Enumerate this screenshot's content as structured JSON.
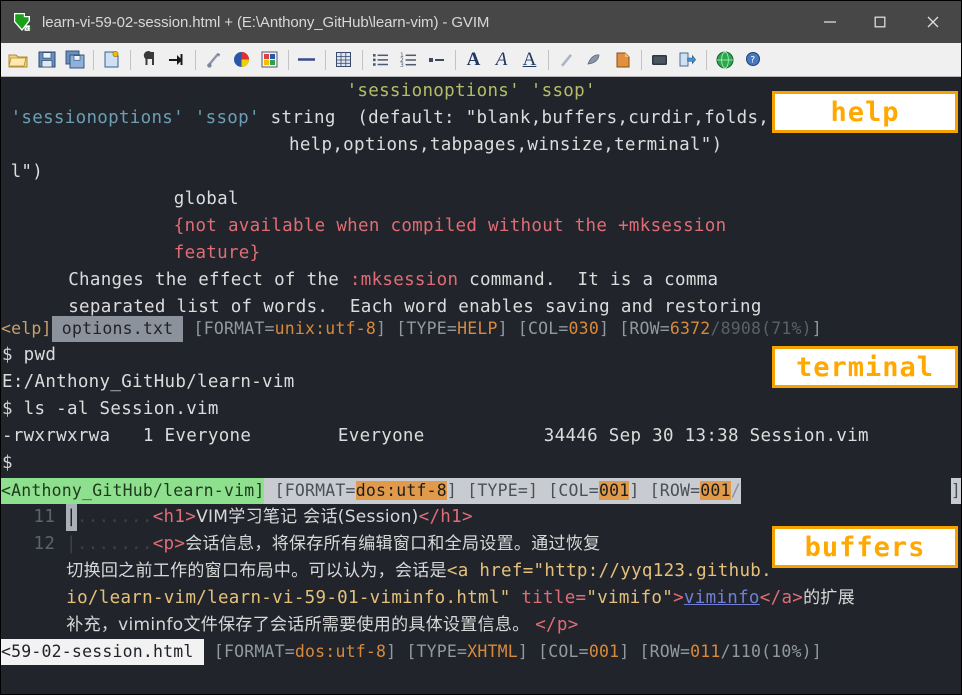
{
  "window": {
    "title": "learn-vi-59-02-session.html + (E:\\Anthony_GitHub\\learn-vim) - GVIM",
    "logo_name": "vim-logo",
    "controls": {
      "minimize": "minimize",
      "maximize": "maximize",
      "close": "close"
    }
  },
  "toolbar": {
    "items": [
      {
        "name": "open-file-icon",
        "tip": "Open"
      },
      {
        "name": "save-file-icon",
        "tip": "Save"
      },
      {
        "name": "save-all-icon",
        "tip": "Save All"
      },
      {
        "name": "print-icon",
        "tip": "Print"
      },
      {
        "name": "undo-icon",
        "tip": "Undo"
      },
      {
        "name": "redo-icon",
        "tip": "Redo"
      },
      {
        "name": "cut-icon",
        "tip": "Cut"
      },
      {
        "name": "copy-icon",
        "tip": "Copy"
      },
      {
        "name": "paste-icon",
        "tip": "Paste"
      },
      {
        "name": "find-icon",
        "tip": "Find"
      },
      {
        "name": "replace-icon",
        "tip": "Find and Replace"
      },
      {
        "name": "list-icon",
        "tip": "List"
      },
      {
        "name": "numbered-list-icon",
        "tip": "Numbered List"
      },
      {
        "name": "indent-icon",
        "tip": "Indent"
      },
      {
        "name": "bold-icon",
        "tip": "Bold",
        "glyph": "A"
      },
      {
        "name": "italic-icon",
        "tip": "Italic",
        "glyph": "A"
      },
      {
        "name": "underline-icon",
        "tip": "Underline",
        "glyph": "A"
      },
      {
        "name": "run-script-icon",
        "tip": "Run"
      },
      {
        "name": "make-icon",
        "tip": "Make"
      },
      {
        "name": "build-tags-icon",
        "tip": "Build Tags"
      },
      {
        "name": "shell-icon",
        "tip": "Shell"
      },
      {
        "name": "next-error-icon",
        "tip": "Next Error"
      },
      {
        "name": "help-icon",
        "tip": "Help"
      },
      {
        "name": "find-help-icon",
        "tip": "Find Help"
      }
    ]
  },
  "annotations": {
    "help": "help",
    "terminal": "terminal",
    "buffers": "buffers",
    "color": "#ffa800"
  },
  "help_pane": {
    "lines": [
      {
        "indent": 36,
        "parts": [
          {
            "t": "'sessionoptions'",
            "c": "c-strg"
          },
          {
            "t": " 'ssop'",
            "c": "c-strg"
          }
        ]
      },
      {
        "indent": 1,
        "parts": [
          {
            "t": "'sessionoptions' 'ssop'",
            "c": "c-str"
          },
          {
            "t": " string  (default: \"blank,buffers,curdir,folds,",
            "c": "c-txt"
          }
        ]
      },
      {
        "indent": 30,
        "parts": [
          {
            "t": "help,options,tabpages,winsize,terminal\")",
            "c": "c-txt"
          }
        ]
      },
      {
        "indent": 1,
        "parts": [
          {
            "t": "l\")",
            "c": "c-txt"
          }
        ]
      },
      {
        "indent": 18,
        "parts": [
          {
            "t": "global",
            "c": "c-txt"
          }
        ]
      },
      {
        "indent": 18,
        "parts": [
          {
            "t": "{not available when compiled without the +mksession",
            "c": "c-special"
          }
        ]
      },
      {
        "indent": 18,
        "parts": [
          {
            "t": "feature}",
            "c": "c-special"
          }
        ]
      },
      {
        "indent": 7,
        "parts": [
          {
            "t": "Changes the effect of the ",
            "c": "c-txt"
          },
          {
            "t": ":mksession",
            "c": "c-special"
          },
          {
            "t": " command.  It is a comma",
            "c": "c-txt"
          }
        ]
      },
      {
        "indent": 7,
        "parts": [
          {
            "t": "separated list of words.  Each word enables saving and restoring",
            "c": "c-txt"
          }
        ]
      }
    ],
    "statusline": {
      "name_prefix": "<elp]",
      "filename": " options.txt ",
      "format_key": "[FORMAT=",
      "format_val": "unix:utf-8",
      "format_end": "]",
      "type_key": "[TYPE=",
      "type_val": "HELP",
      "type_end": "]",
      "col_key": "[COL=",
      "col_val": "030",
      "col_end": "]",
      "row_key": "[ROW=",
      "row_val": "6372",
      "row_sep": "/",
      "row_total": "8908(71%)",
      "row_end": "]"
    }
  },
  "terminal_pane": {
    "lines": [
      {
        "prompt": "$",
        "text": " pwd"
      },
      {
        "prompt": "",
        "text": "E:/Anthony_GitHub/learn-vim"
      },
      {
        "prompt": "$",
        "text": " ls -al Session.vim"
      },
      {
        "prompt": "",
        "text": "-rwxrwxrwa   1 Everyone        Everyone           34446 Sep 30 13:38 Session.vim"
      },
      {
        "prompt": "$",
        "text": ""
      }
    ],
    "statusline": {
      "name_prefix": "<Anthony_GitHub/learn-vim]",
      "format_key": "[FORMAT=",
      "format_val": "dos:utf-8",
      "format_end": "]",
      "type_key": "[TYPE=",
      "type_val": "",
      "type_end": "]",
      "col_key": "[COL=",
      "col_val": "001",
      "col_end": "]",
      "row_key": "[ROW=",
      "row_val": "001",
      "row_sep": "/",
      "tail_bracket": "]"
    }
  },
  "buffer_pane": {
    "lines": [
      {
        "num": "11",
        "cursor": true,
        "guide": ".......",
        "parts": [
          {
            "t": "<h1>",
            "c": "c-tag"
          },
          {
            "t": "VIM学习笔记 会话(Session)",
            "c": "c-cjk"
          },
          {
            "t": "</h1>",
            "c": "c-tag"
          }
        ]
      },
      {
        "num": "12",
        "cursor": false,
        "guide": ".......",
        "parts": [
          {
            "t": "<p>",
            "c": "c-tag"
          },
          {
            "t": "会话信息，将保存所有编辑窗口和全局设置。通过恢复",
            "c": "c-cjk"
          }
        ]
      },
      {
        "num": "",
        "cursor": false,
        "guide": "",
        "parts": [
          {
            "t": "切换回之前工作的窗口布局中。可以认为，会话是",
            "c": "c-cjk"
          },
          {
            "t": "<a href=\"http://yyq123.github.",
            "c": "c-attr"
          }
        ]
      },
      {
        "num": "",
        "cursor": false,
        "guide": "",
        "parts": [
          {
            "t": "io/learn-vim/learn-vi-59-01-viminfo.html\" ",
            "c": "c-attr"
          },
          {
            "t": "title=",
            "c": "c-attrn"
          },
          {
            "t": "\"vimifo\"",
            "c": "c-attr"
          },
          {
            "t": ">",
            "c": "c-tag"
          },
          {
            "t": "viminfo",
            "c": "c-link"
          },
          {
            "t": "</a>",
            "c": "c-tag"
          },
          {
            "t": "的扩展",
            "c": "c-cjk"
          }
        ]
      },
      {
        "num": "",
        "cursor": false,
        "guide": "",
        "parts": [
          {
            "t": "补充，viminfo文件保存了会话所需要使用的具体设置信息。 ",
            "c": "c-cjk"
          },
          {
            "t": "</p>",
            "c": "c-tag"
          }
        ]
      }
    ],
    "statusline": {
      "name_prefix": "<59-02-session.html ",
      "format_key": "[FORMAT=",
      "format_val": "dos:utf-8",
      "format_end": "]",
      "type_key": "[TYPE=",
      "type_val": "XHTML",
      "type_end": "]",
      "col_key": "[COL=",
      "col_val": "001",
      "col_end": "]",
      "row_key": "[ROW=",
      "row_val": "011",
      "row_sep": "/",
      "row_total": "110(10%)",
      "row_end": "]"
    }
  }
}
